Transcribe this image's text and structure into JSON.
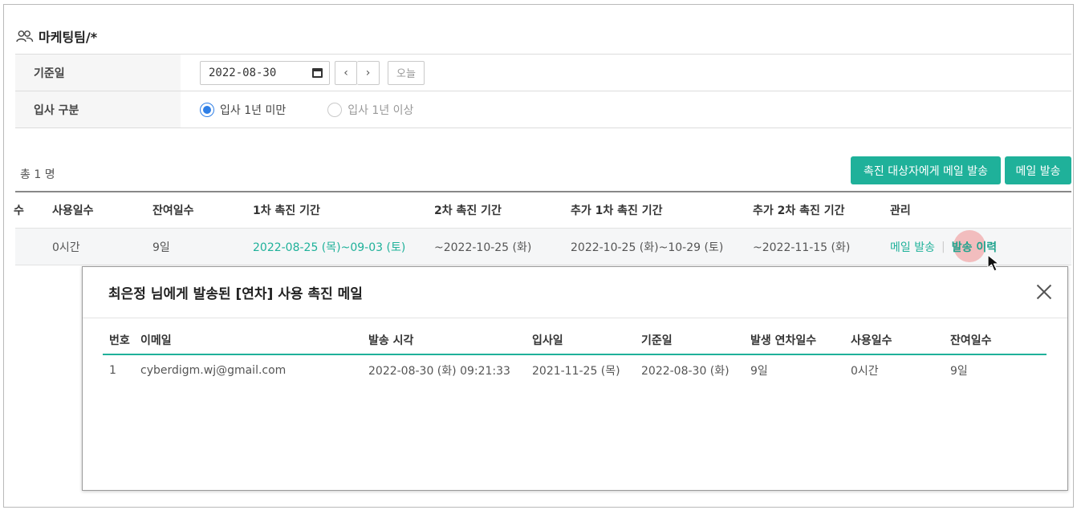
{
  "page": {
    "title": "마케팅팀/*"
  },
  "filter": {
    "base_date_label": "기준일",
    "base_date_value": "2022-08-30",
    "prev_label": "‹",
    "next_label": "›",
    "today_label": "오늘",
    "join_type_label": "입사 구분",
    "options": [
      {
        "label": "입사 1년 미만",
        "selected": true
      },
      {
        "label": "입사 1년 이상",
        "selected": false
      }
    ]
  },
  "summary": {
    "count_text": "총 1 명"
  },
  "actions": {
    "send_to_targets": "촉진 대상자에게 메일 발송",
    "send_mail": "메일 발송"
  },
  "table": {
    "columns": [
      "수",
      "사용일수",
      "잔여일수",
      "1차 촉진 기간",
      "2차 촉진 기간",
      "추가 1차 촉진 기간",
      "추가 2차 촉진 기간",
      "관리"
    ],
    "row": {
      "used": "0시간",
      "remaining": "9일",
      "first_period": "2022-08-25 (목)~09-03 (토)",
      "second_period": "~2022-10-25 (화)",
      "extra_first_period": "2022-10-25 (화)~10-29 (토)",
      "extra_second_period": "~2022-11-15 (화)",
      "action_send": "메일 발송",
      "action_history": "발송 이력"
    }
  },
  "modal": {
    "title": "최은정 님에게 발송된 [연차] 사용 촉진 메일",
    "columns": [
      "번호",
      "이메일",
      "발송 시각",
      "입사일",
      "기준일",
      "발생 연차일수",
      "사용일수",
      "잔여일수"
    ],
    "rows": [
      {
        "no": "1",
        "email": "cyberdigm.wj@gmail.com",
        "sent_at": "2022-08-30 (화) 09:21:33",
        "join_date": "2021-11-25 (목)",
        "base_date": "2022-08-30 (화)",
        "granted": "9일",
        "used": "0시간",
        "remaining": "9일"
      }
    ]
  },
  "colors": {
    "accent": "#1fb19a",
    "radio": "#2f7fe6"
  },
  "icons": {
    "team": "users-icon",
    "calendar": "calendar-icon",
    "close": "close-icon",
    "cursor": "mouse-pointer-icon"
  }
}
